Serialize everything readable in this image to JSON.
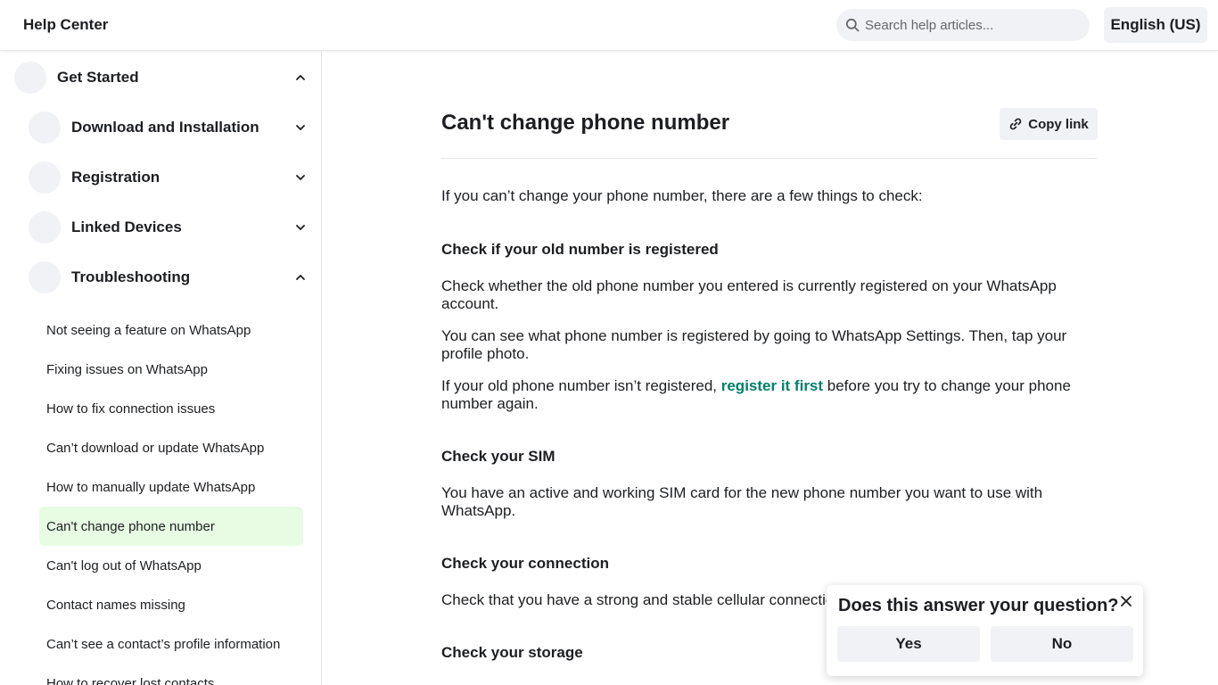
{
  "header": {
    "brand": "Help Center",
    "search_placeholder": "Search help articles...",
    "language": "English (US)"
  },
  "sidebar": {
    "top": {
      "label": "Get Started",
      "expanded": true
    },
    "sections": [
      {
        "label": "Download and Installation",
        "expanded": false
      },
      {
        "label": "Registration",
        "expanded": false
      },
      {
        "label": "Linked Devices",
        "expanded": false
      },
      {
        "label": "Troubleshooting",
        "expanded": true
      }
    ],
    "items": [
      {
        "label": "Not seeing a feature on WhatsApp"
      },
      {
        "label": "Fixing issues on WhatsApp"
      },
      {
        "label": "How to fix connection issues"
      },
      {
        "label": "Can’t download or update WhatsApp"
      },
      {
        "label": "How to manually update WhatsApp"
      },
      {
        "label": "Can't change phone number",
        "active": true
      },
      {
        "label": "Can't log out of WhatsApp"
      },
      {
        "label": "Contact names missing"
      },
      {
        "label": "Can’t see a contact’s profile information"
      },
      {
        "label": "How to recover lost contacts"
      }
    ]
  },
  "article": {
    "title": "Can't change phone number",
    "copy_link": "Copy link",
    "intro": "If you can’t change your phone number, there are a few things to check:",
    "s1": {
      "heading": "Check if your old number is registered",
      "p1": "Check whether the old phone number you entered is currently registered on your WhatsApp account.",
      "p2": "You can see what phone number is registered by going to WhatsApp Settings. Then, tap your profile photo.",
      "p3_before": "If your old phone number isn’t registered, ",
      "p3_link": "register it first",
      "p3_after": " before you try to change your phone number again."
    },
    "s2": {
      "heading": "Check your SIM",
      "p1": "You have an active and working SIM card for the new phone number you want to use with WhatsApp."
    },
    "s3": {
      "heading": "Check your connection",
      "p1": "Check that you have a strong and stable cellular connection."
    },
    "s4": {
      "heading": "Check your storage"
    }
  },
  "feedback": {
    "question": "Does this answer your question?",
    "yes": "Yes",
    "no": "No"
  },
  "colors": {
    "accent_link": "#008069",
    "active_item_bg": "#e7fce3",
    "button_bg": "#f0f2f5"
  }
}
